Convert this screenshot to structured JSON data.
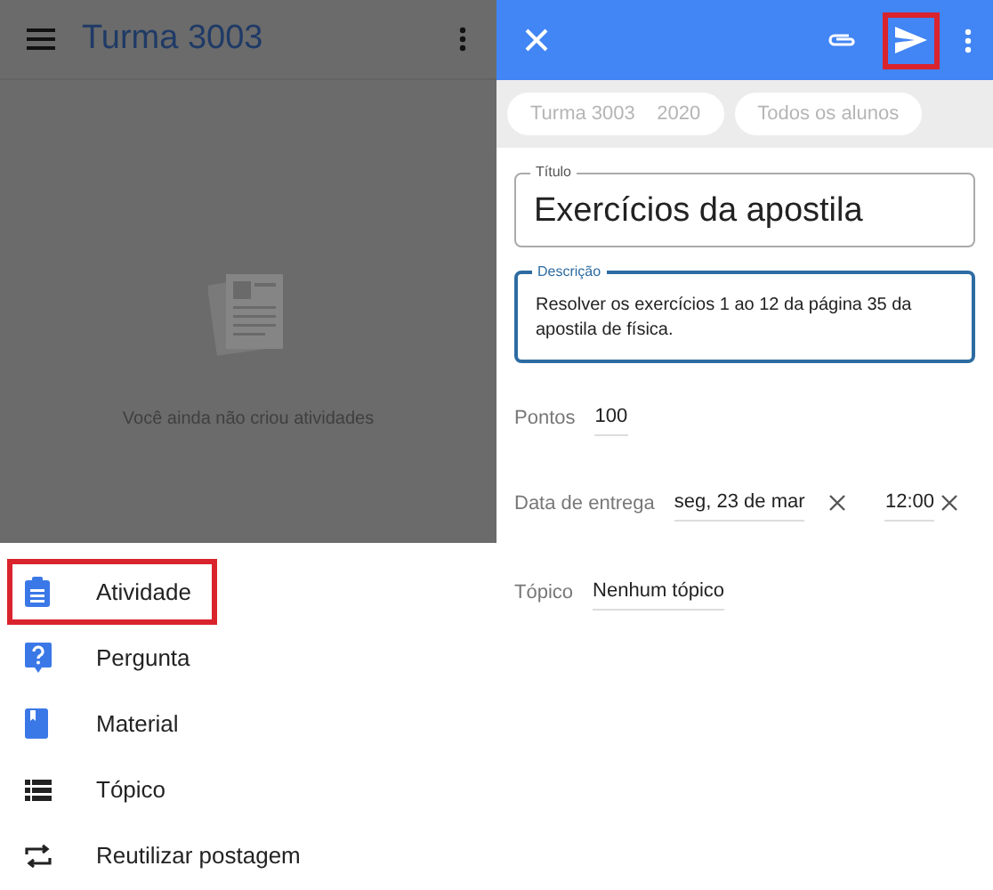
{
  "class_screen": {
    "title": "Turma 3003",
    "empty_message": "Você ainda não criou atividades"
  },
  "create_menu": [
    {
      "label": "Atividade",
      "kind": "assignment",
      "highlighted": true
    },
    {
      "label": "Pergunta",
      "kind": "question",
      "highlighted": false
    },
    {
      "label": "Material",
      "kind": "material",
      "highlighted": false
    },
    {
      "label": "Tópico",
      "kind": "topic",
      "highlighted": false
    },
    {
      "label": "Reutilizar postagem",
      "kind": "reuse",
      "highlighted": false
    }
  ],
  "editor": {
    "toolbar": {
      "send_highlighted": true
    },
    "chips": [
      {
        "label": "Turma 3003",
        "sub": "2020"
      },
      {
        "label": "Todos os alunos"
      }
    ],
    "title_field": {
      "label": "Título",
      "value": "Exercícios da apostila"
    },
    "description_field": {
      "label": "Descrição",
      "value": "Resolver os exercícios 1 ao 12 da página 35 da apostila de física.",
      "focused": true
    },
    "points": {
      "label": "Pontos",
      "value": "100"
    },
    "due": {
      "label": "Data de entrega",
      "date": "seg, 23 de mar",
      "time": "12:00"
    },
    "topic": {
      "label": "Tópico",
      "value": "Nenhum tópico"
    }
  }
}
